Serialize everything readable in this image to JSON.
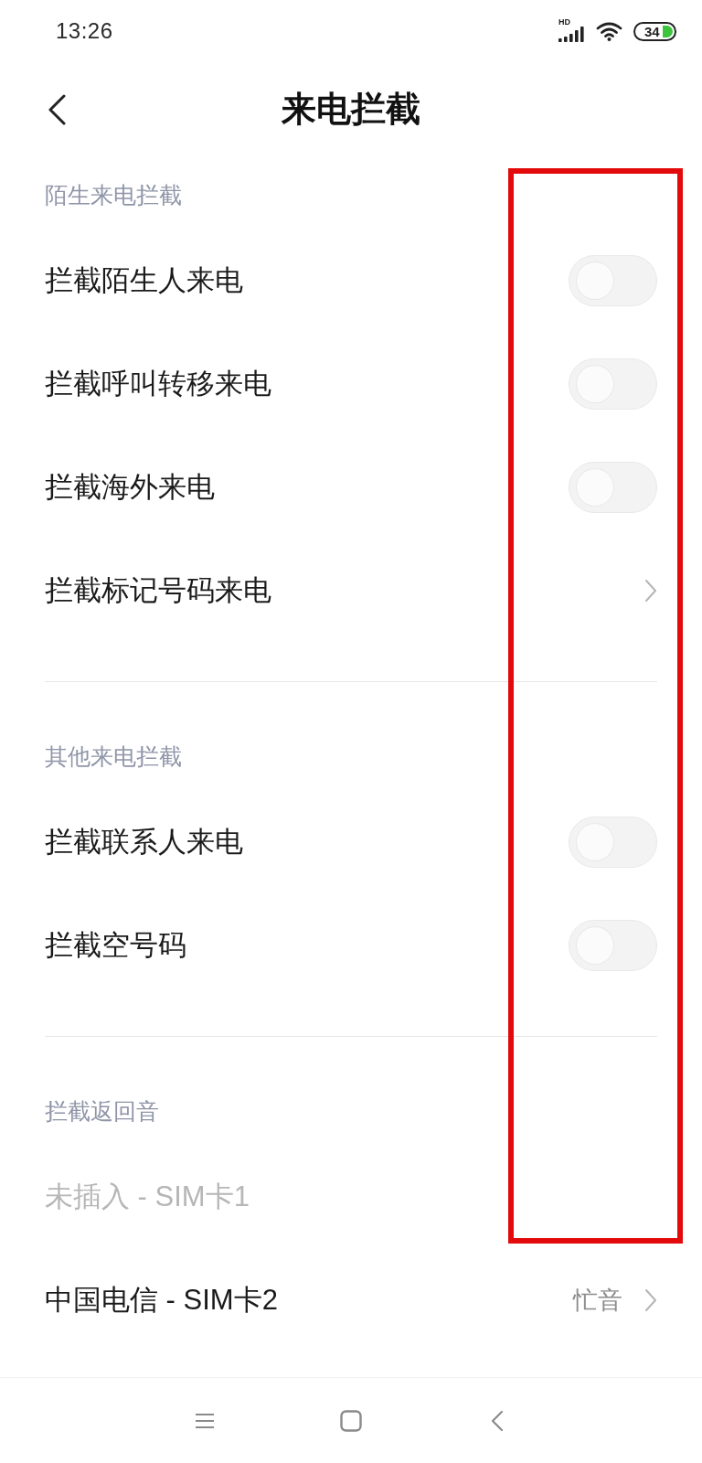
{
  "status_bar": {
    "time": "13:26",
    "network_type": "HD",
    "battery": "34"
  },
  "header": {
    "title": "来电拦截"
  },
  "sections": [
    {
      "title": "陌生来电拦截",
      "items": [
        {
          "kind": "toggle",
          "label": "拦截陌生人来电",
          "on": false,
          "disabled": false
        },
        {
          "kind": "toggle",
          "label": "拦截呼叫转移来电",
          "on": false,
          "disabled": false
        },
        {
          "kind": "toggle",
          "label": "拦截海外来电",
          "on": false,
          "disabled": false
        },
        {
          "kind": "link",
          "label": "拦截标记号码来电",
          "disabled": false
        }
      ]
    },
    {
      "title": "其他来电拦截",
      "items": [
        {
          "kind": "toggle",
          "label": "拦截联系人来电",
          "on": false,
          "disabled": false
        },
        {
          "kind": "toggle",
          "label": "拦截空号码",
          "on": false,
          "disabled": false
        }
      ]
    },
    {
      "title": "拦截返回音",
      "items": [
        {
          "kind": "link",
          "label": "未插入 - SIM卡1",
          "disabled": true
        },
        {
          "kind": "link",
          "label": "中国电信 - SIM卡2",
          "value": "忙音",
          "disabled": false
        }
      ]
    }
  ],
  "annotation": {
    "kind": "rectangle"
  }
}
